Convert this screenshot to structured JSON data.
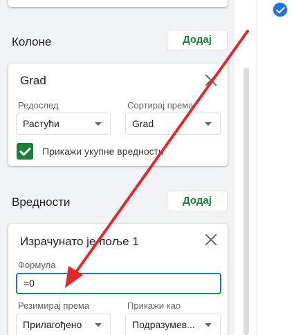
{
  "columns": {
    "heading": "Колоне",
    "add_label": "Додај",
    "card": {
      "title": "Grad",
      "order_label": "Редослед",
      "order_value": "Растући",
      "sort_label": "Сортирај према",
      "sort_value": "Grad",
      "show_totals_label": "Прикажи укупне вредности",
      "show_totals_checked": true
    }
  },
  "values": {
    "heading": "Вредности",
    "add_label": "Додај",
    "card": {
      "title": "Израчунато је поље 1",
      "formula_label": "Формула",
      "formula_value": "=0",
      "summarize_label": "Резимирај према",
      "summarize_value": "Прилагођено",
      "show_as_label": "Прикажи као",
      "show_as_value": "Подразумев..."
    }
  },
  "icons": {
    "close": "close-icon",
    "dropdown": "chevron-down-icon",
    "checkbox": "check-icon",
    "badge": "check-circle-icon"
  },
  "colors": {
    "accent_green": "#188038",
    "focus_blue": "#1a73e8",
    "annotation_red": "#e8252b"
  }
}
